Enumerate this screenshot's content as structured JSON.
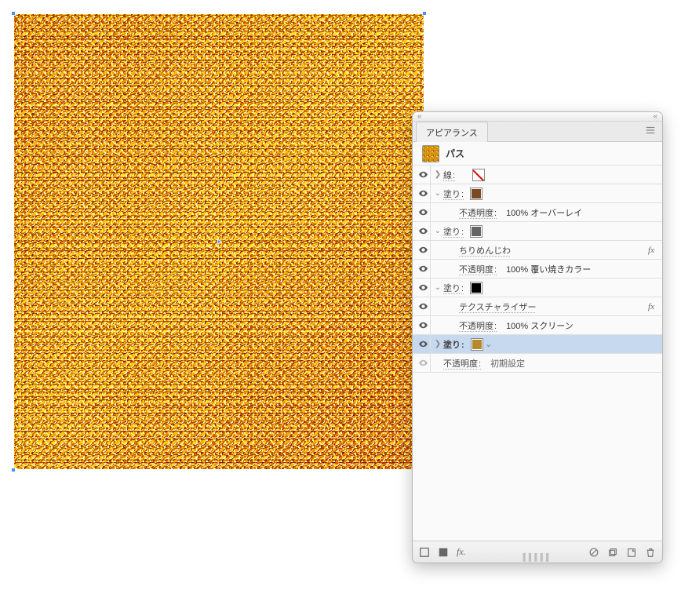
{
  "panel": {
    "tab": "アピアランス",
    "object_type": "パス",
    "opacity_label": "不透明度",
    "rows": {
      "stroke_label": "線",
      "fill_label": "塗り",
      "f1_opacity_value": "100% オーバーレイ",
      "f2_effect": "ちりめんじわ",
      "f2_opacity_value": "100% 覆い焼きカラー",
      "f3_effect": "テクスチャライザー",
      "f3_opacity_value": "100% スクリーン",
      "default_opacity": "初期設定"
    }
  }
}
